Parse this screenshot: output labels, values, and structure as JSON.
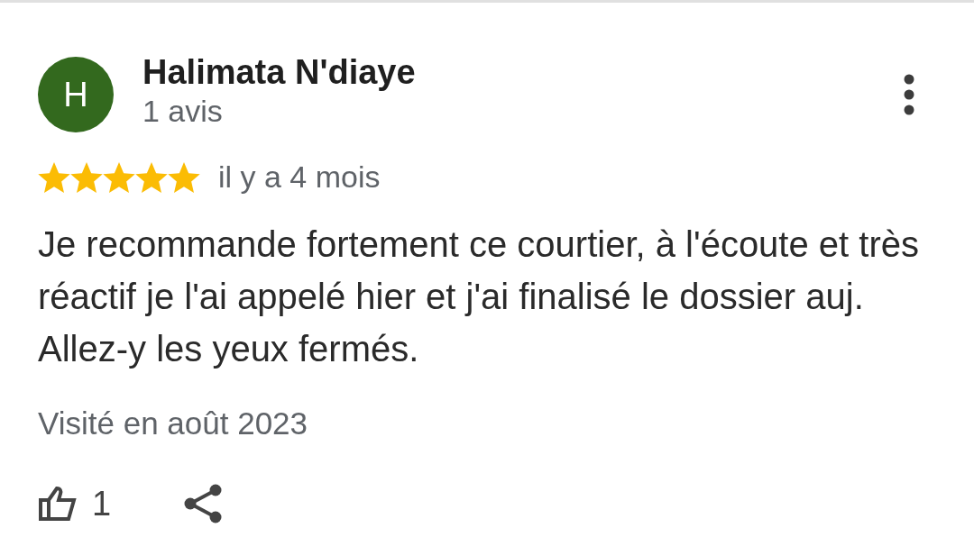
{
  "review": {
    "author": {
      "initial": "H",
      "name": "Halimata N'diaye",
      "review_count": "1 avis"
    },
    "stars": 5,
    "time": "il y a 4 mois",
    "text": "Je recommande fortement ce courtier, à l'écoute et très réactif je l'ai appelé hier et j'ai finalisé le dossier auj. Allez-y les yeux fermés.",
    "visited": "Visité en août 2023",
    "likes": "1"
  }
}
